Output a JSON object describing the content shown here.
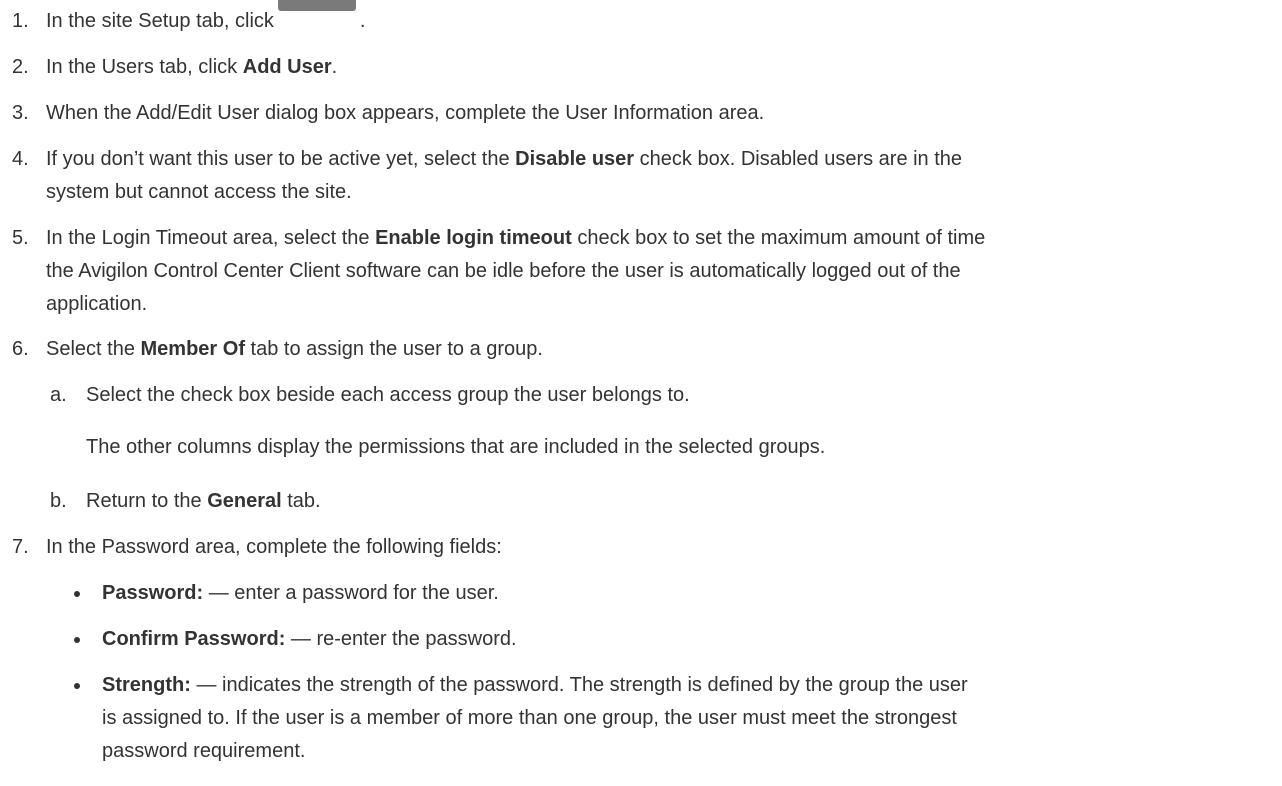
{
  "steps": [
    {
      "num": "1.",
      "pre": "In the site Setup tab, click",
      "post": "."
    },
    {
      "num": "2.",
      "pre": "In the Users tab, click ",
      "bold": "Add User",
      "post": "."
    },
    {
      "num": "3.",
      "text": "When the Add/Edit User dialog box appears, complete the User Information area."
    },
    {
      "num": "4.",
      "pre": "If you don’t want this user to be active yet, select the ",
      "bold": "Disable user",
      "post": " check box. Disabled users are in the",
      "line2": "system but cannot access the site."
    },
    {
      "num": "5.",
      "pre": "In the Login Timeout area, select the ",
      "bold": "Enable login timeout",
      "post": " check box to set the maximum amount of time",
      "line2": "the Avigilon Control Center Client software can be idle before the user is automatically logged out of the",
      "line3": "application."
    },
    {
      "num": "6.",
      "pre": "Select the ",
      "bold": "Member Of",
      "post": " tab to assign the user to a group."
    },
    {
      "num": "7.",
      "text": "In the Password area, complete the following fields:"
    }
  ],
  "substeps": [
    {
      "num": "a.",
      "text": "Select the check box beside each access group the user belongs to."
    },
    {
      "num": "b.",
      "pre": "Return to the ",
      "bold": "General",
      "post": " tab."
    }
  ],
  "note": "The other columns display the permissions that are included in the selected groups.",
  "bullets": [
    {
      "bold": "Password:",
      "post": " — enter a password for the user."
    },
    {
      "bold": "Confirm Password:",
      "post": " — re-enter the password."
    },
    {
      "bold": "Strength:",
      "post": " — indicates the strength of the password. The strength is defined by the group the user",
      "line2": "is assigned to. If the user is a member of more than one group, the user must meet the strongest",
      "line3": "password requirement."
    }
  ],
  "icons": {
    "setup_button": "user-setup-button-icon"
  },
  "colors": {
    "text": "#333333",
    "button": "#7a7a7a"
  }
}
